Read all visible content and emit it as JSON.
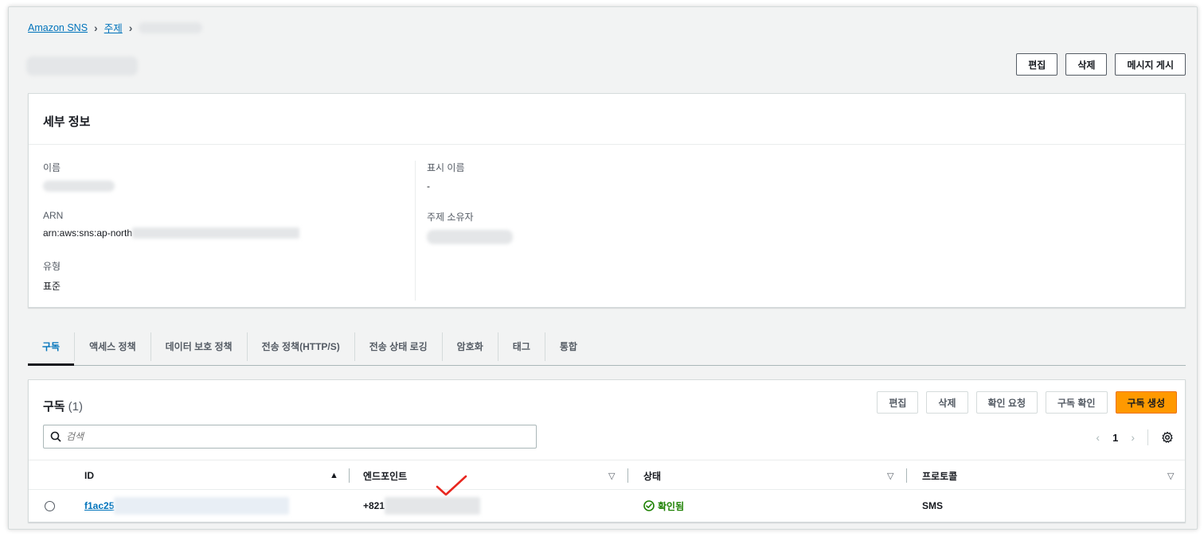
{
  "breadcrumb": {
    "items": [
      "Amazon SNS",
      "주제"
    ]
  },
  "header": {
    "edit_label": "편집",
    "delete_label": "삭제",
    "publish_label": "메시지 게시"
  },
  "details": {
    "title": "세부 정보",
    "name_label": "이름",
    "arn_label": "ARN",
    "arn_value": "arn:aws:sns:ap-north",
    "type_label": "유형",
    "type_value": "표준",
    "display_name_label": "표시 이름",
    "display_name_value": "-",
    "owner_label": "주제 소유자"
  },
  "tabs": [
    "구독",
    "액세스 정책",
    "데이터 보호 정책",
    "전송 정책(HTTP/S)",
    "전송 상태 로깅",
    "암호화",
    "태그",
    "통합"
  ],
  "subscriptions": {
    "title": "구독",
    "count": "(1)",
    "actions": {
      "edit": "편집",
      "delete": "삭제",
      "request_confirm": "확인 요청",
      "confirm": "구독 확인",
      "create": "구독 생성"
    },
    "search_placeholder": "검색",
    "page": "1",
    "columns": {
      "id": "ID",
      "endpoint": "엔드포인트",
      "status": "상태",
      "protocol": "프로토콜"
    },
    "rows": [
      {
        "id": "f1ac25",
        "endpoint": "+821",
        "status": "확인됨",
        "protocol": "SMS"
      }
    ]
  },
  "colors": {
    "link": "#0073bb",
    "primary": "#ff9900",
    "success": "#1d8102",
    "annotation": "#e8261e"
  },
  "icons": [
    "chevron-right-icon",
    "search-icon",
    "chevron-left-icon",
    "gear-icon",
    "sort-up-icon",
    "sort-down-icon",
    "check-circle-icon",
    "red-check-annotation"
  ]
}
